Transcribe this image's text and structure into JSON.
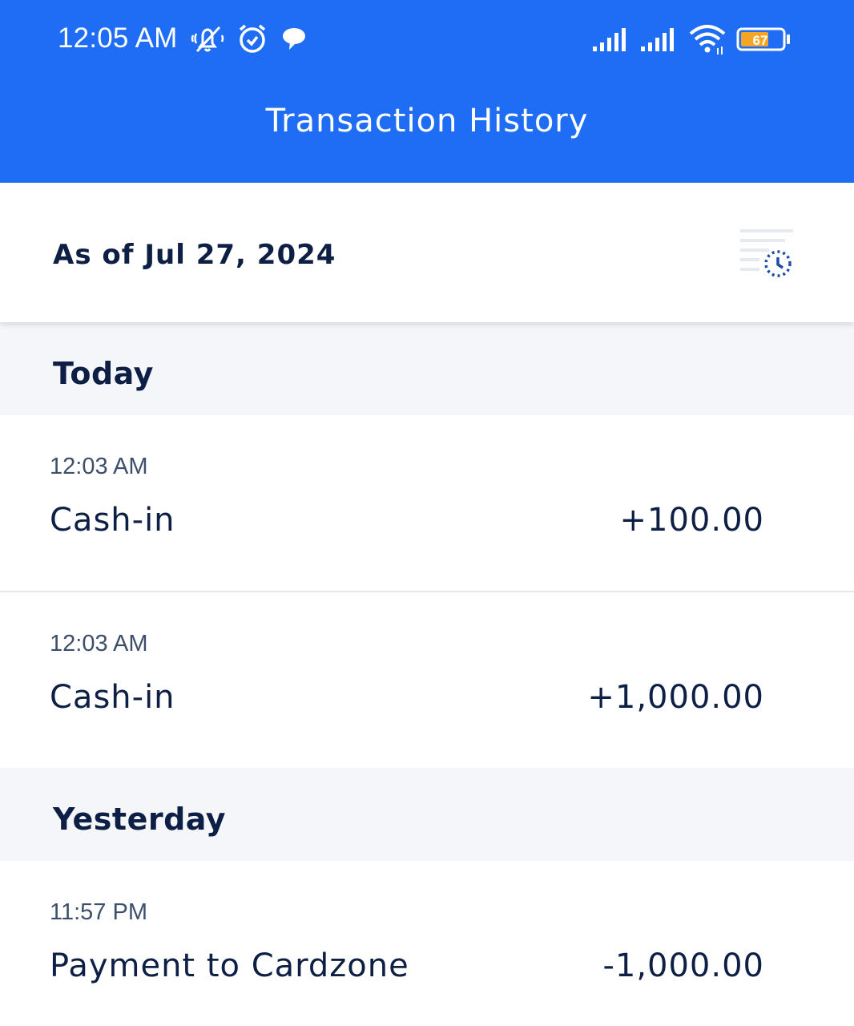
{
  "status_bar": {
    "time": "12:05 AM",
    "battery_level": "67",
    "icons": [
      "bell-muted-icon",
      "alarm-icon",
      "chat-bubble-icon",
      "signal-icon",
      "signal-icon",
      "wifi-icon",
      "battery-icon"
    ],
    "battery_color": "#f5a524"
  },
  "header": {
    "title": "Transaction History",
    "background_color": "#1f6df5"
  },
  "asof": {
    "label": "As of Jul 27, 2024",
    "icon": "history-filter-icon",
    "icon_accent": "#1f6df5"
  },
  "sections": [
    {
      "title": "Today",
      "transactions": [
        {
          "time": "12:03 AM",
          "description": "Cash-in",
          "amount": "+100.00"
        },
        {
          "time": "12:03 AM",
          "description": "Cash-in",
          "amount": "+1,000.00"
        }
      ]
    },
    {
      "title": "Yesterday",
      "transactions": [
        {
          "time": "11:57 PM",
          "description": "Payment to Cardzone",
          "amount": "-1,000.00"
        }
      ]
    }
  ]
}
